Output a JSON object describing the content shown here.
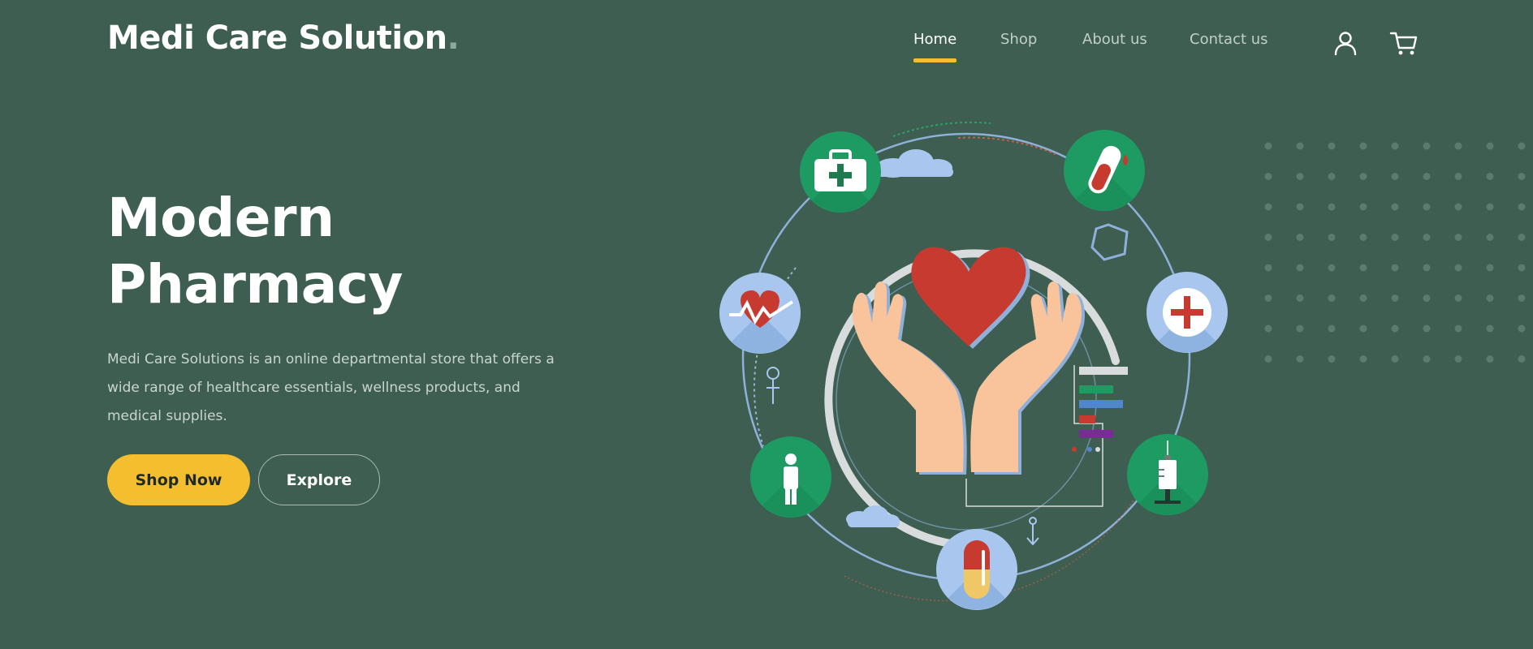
{
  "brand": {
    "name": "Medi Care Solution",
    "dot": "."
  },
  "nav": {
    "items": [
      {
        "label": "Home",
        "active": true
      },
      {
        "label": "Shop",
        "active": false
      },
      {
        "label": "About us",
        "active": false
      },
      {
        "label": "Contact us",
        "active": false
      }
    ],
    "icons": [
      "user-icon",
      "cart-icon"
    ]
  },
  "hero": {
    "title_line1": "Modern",
    "title_line2": "Pharmacy",
    "description": "Medi Care Solutions is an online departmental store that offers a wide range of healthcare essentials, wellness products, and medical supplies.",
    "primary_button": "Shop Now",
    "secondary_button": "Explore"
  },
  "illustration_icons": [
    "first-aid-kit-icon",
    "test-tube-icon",
    "heartbeat-icon",
    "medical-cross-icon",
    "patient-icon",
    "syringe-icon",
    "capsule-icon",
    "hands-heart-icon"
  ],
  "colors": {
    "background": "#3d5e50",
    "accent": "#f5be2f",
    "icon_green": "#1e9b62",
    "icon_blue": "#a9c7ee",
    "heart_red": "#c73a30",
    "skin": "#f9c39b"
  }
}
